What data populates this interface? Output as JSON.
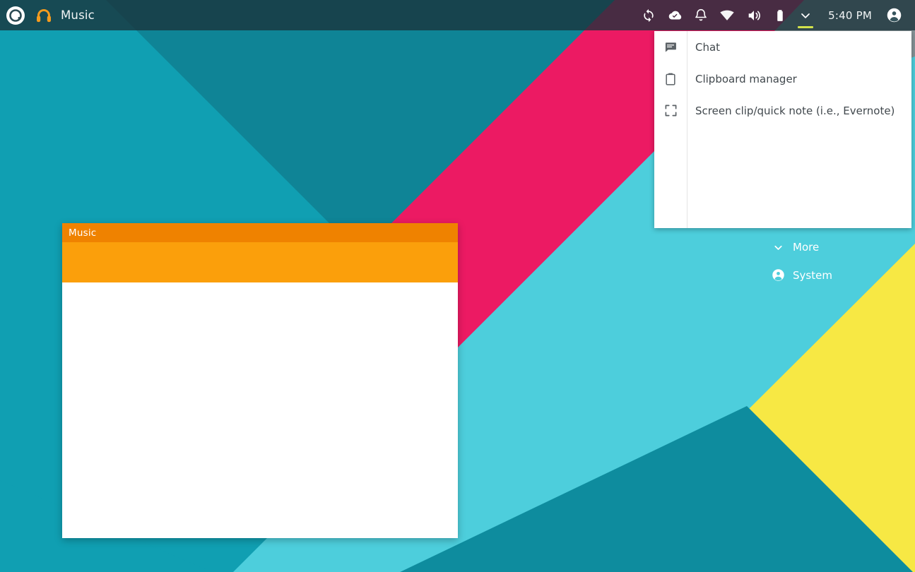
{
  "topbar": {
    "logo_icon": "circle-logo-icon",
    "app_icon": "headphones-icon",
    "app_title": "Music",
    "clock": "5:40 PM",
    "tray_icons": [
      {
        "name": "sync-icon",
        "label": "Sync"
      },
      {
        "name": "cloud-check-icon",
        "label": "Cloud"
      },
      {
        "name": "bell-icon",
        "label": "Notifications"
      },
      {
        "name": "wifi-icon",
        "label": "Network"
      },
      {
        "name": "volume-icon",
        "label": "Sound"
      },
      {
        "name": "battery-icon",
        "label": "Battery"
      },
      {
        "name": "chevron-down-icon",
        "label": "More"
      }
    ],
    "account_icon": "account-circle-icon",
    "active_indicator_color": "#d2e24b"
  },
  "tray_menu": {
    "items": [
      {
        "icon": "chat-bubble-icon",
        "label": "Chat"
      },
      {
        "icon": "clipboard-icon",
        "label": "Clipboard manager"
      },
      {
        "icon": "screen-clip-icon",
        "label": "Screen clip/quick note (i.e., Evernote)"
      }
    ]
  },
  "desktop": {
    "more_label": "More",
    "more_icon": "chevron-down-icon",
    "system_label": "System",
    "system_icon": "account-circle-icon"
  },
  "music_window": {
    "title": "Music",
    "titlebar_color": "#ef8200",
    "toolbar_color": "#fb9f0b",
    "body_color": "#ffffff"
  },
  "wallpaper": {
    "colors": {
      "teal_dark": "#0E8C9E",
      "teal_deep": "#107E8E",
      "teal_mid": "#1AACBD",
      "cyan_light": "#4FD0DE",
      "magenta": "#EC1A63",
      "gray": "#8C9296",
      "yellow": "#F7E844"
    }
  }
}
